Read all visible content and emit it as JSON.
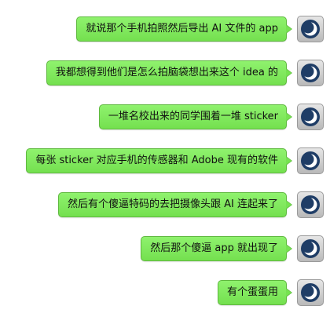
{
  "messages": [
    {
      "text": "就说那个手机拍照然后导出 AI 文件的 app",
      "avatar_icon": "moon-avatar-icon"
    },
    {
      "text": "我都想得到他们是怎么拍脑袋想出来这个 idea 的",
      "avatar_icon": "moon-avatar-icon"
    },
    {
      "text": "一堆名校出来的同学围着一堆 sticker",
      "avatar_icon": "moon-avatar-icon"
    },
    {
      "text": "每张 sticker 对应手机的传感器和 Adobe 现有的软件",
      "avatar_icon": "moon-avatar-icon"
    },
    {
      "text": "然后有个傻逼特码的去把摄像头跟 AI 连起来了",
      "avatar_icon": "moon-avatar-icon"
    },
    {
      "text": "然后那个傻逼 app 就出现了",
      "avatar_icon": "moon-avatar-icon"
    },
    {
      "text": "有个蛋蛋用",
      "avatar_icon": "moon-avatar-icon"
    }
  ],
  "colors": {
    "bubble": "#7ee85a",
    "bubble_border": "#5fb83f",
    "avatar_bg": "#d0d0d0",
    "avatar_glyph": "#1f3d66"
  }
}
